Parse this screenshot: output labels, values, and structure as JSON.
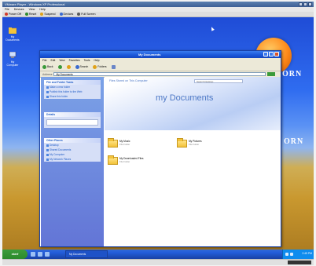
{
  "host": {
    "title": "VMware Player - Windows XP Professional",
    "menu": [
      "File",
      "Devices",
      "View",
      "Help"
    ],
    "tools": [
      {
        "label": "Power Off",
        "color": "#d23a2a"
      },
      {
        "label": "Reset",
        "color": "#2f8b2f"
      },
      {
        "label": "Suspend",
        "color": "#e0a21a"
      },
      {
        "label": "Devices",
        "color": "#3a6ad0"
      },
      {
        "label": "Full Screen",
        "color": "#5a5a5a"
      }
    ]
  },
  "desktop": {
    "icons": [
      {
        "label": "My Documents"
      },
      {
        "label": "My Computer"
      }
    ],
    "brand_text": "ORN",
    "brand_text_2": "ORN"
  },
  "explorer": {
    "title": "My Documents",
    "menu": [
      "File",
      "Edit",
      "View",
      "Favorites",
      "Tools",
      "Help"
    ],
    "tools": [
      {
        "label": "Back",
        "color": "#3a9a3a"
      },
      {
        "label": "",
        "color": "#3a9a3a"
      },
      {
        "label": "",
        "color": "#e0a21a"
      },
      {
        "label": "Search",
        "color": "#3a6ad0"
      },
      {
        "label": "Folders",
        "color": "#e0a21a"
      }
    ],
    "address_label": "Address",
    "address_value": "My Documents",
    "taskpane": {
      "sections": [
        {
          "header": "File and Folder Tasks",
          "items": [
            "Make a new folder",
            "Publish this folder to the Web",
            "Share this folder"
          ]
        },
        {
          "header": "Other Places",
          "items": [
            "Desktop",
            "Shared Documents",
            "My Computer",
            "My Network Places"
          ]
        },
        {
          "header": "Details",
          "items": []
        }
      ]
    },
    "content": {
      "header": "Files Stored on This Computer",
      "search_placeholder": "Search Desktop",
      "banner_title": "my Documents",
      "folders": [
        {
          "name": "My Music",
          "info": "File Folder"
        },
        {
          "name": "My Pictures",
          "info": "File Folder"
        },
        {
          "name": "My Downloaded Files",
          "info": "File Folder"
        }
      ]
    }
  },
  "taskbar": {
    "start_label": "start",
    "task_button": "My Documents",
    "clock": "2:45 PM"
  }
}
